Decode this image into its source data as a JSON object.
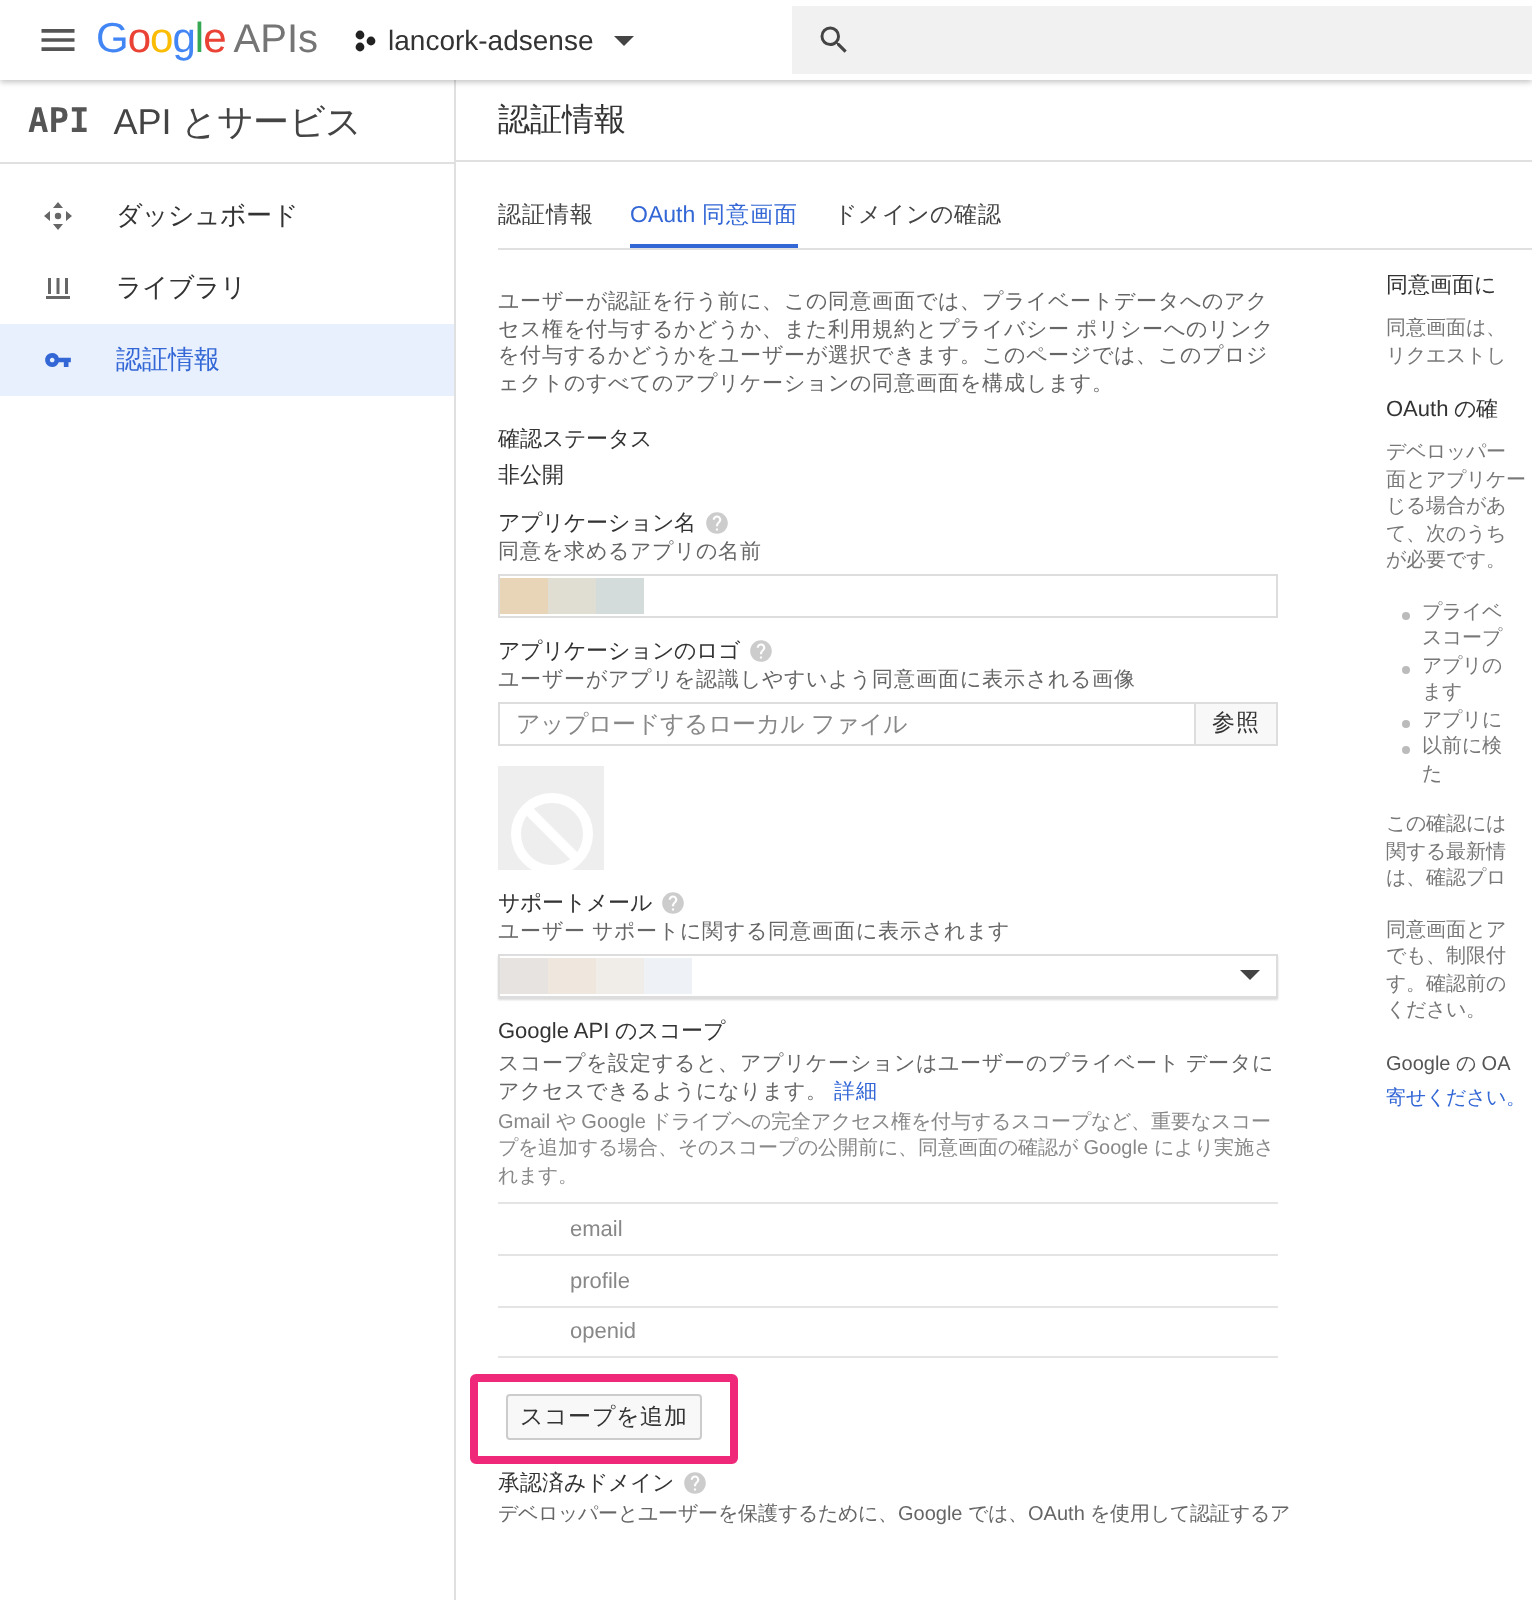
{
  "topbar": {
    "brand": "Google",
    "product": "APIs",
    "project": "lancork-adsense"
  },
  "sidebar": {
    "badge": "API",
    "title": "API とサービス",
    "items": [
      {
        "label": "ダッシュボード",
        "selected": false
      },
      {
        "label": "ライブラリ",
        "selected": false
      },
      {
        "label": "認証情報",
        "selected": true
      }
    ]
  },
  "page_title": "認証情報",
  "tabs": [
    {
      "label": "認証情報",
      "selected": false
    },
    {
      "label": "OAuth 同意画面",
      "selected": true
    },
    {
      "label": "ドメインの確認",
      "selected": false
    }
  ],
  "form": {
    "intro": "ユーザーが認証を行う前に、この同意画面では、プライベートデータへのアクセス権を付与するかどうか、また利用規約とプライバシー ポリシーへのリンクを付与するかどうかをユーザーが選択できます。このページでは、このプロジェクトのすべてのアプリケーションの同意画面を構成します。",
    "status": {
      "label": "確認ステータス",
      "value": "非公開"
    },
    "app_name": {
      "label": "アプリケーション名",
      "hint": "同意を求めるアプリの名前"
    },
    "logo": {
      "label": "アプリケーションのロゴ",
      "hint": "ユーザーがアプリを認識しやすいよう同意画面に表示される画像",
      "placeholder": "アップロードするローカル ファイル",
      "browse": "参照"
    },
    "support_email": {
      "label": "サポートメール",
      "hint": "ユーザー サポートに関する同意画面に表示されます"
    },
    "scopes": {
      "label": "Google API のスコープ",
      "description": "スコープを設定すると、アプリケーションはユーザーのプライベート データにアクセスできるようになります。",
      "link": "詳細",
      "note": "Gmail や Google ドライブへの完全アクセス権を付与するスコープなど、重要なスコープを追加する場合、そのスコープの公開前に、同意画面の確認が Google により実施されます。",
      "items": [
        "email",
        "profile",
        "openid"
      ],
      "add_button": "スコープを追加",
      "add_highlighted": true
    },
    "domains": {
      "label": "承認済みドメイン",
      "description": "デベロッパーとユーザーを保護するために、Google では、OAuth を使用して認証するア"
    }
  },
  "side_panel": {
    "blocks": [
      {
        "kind": "heading",
        "lines": [
          "同意画面に"
        ]
      },
      {
        "kind": "text",
        "lines": [
          "同意画面は、",
          "リクエストし"
        ]
      },
      {
        "kind": "heading",
        "lines": [
          "OAuth の確"
        ]
      },
      {
        "kind": "text",
        "lines": [
          "デベロッパー",
          "面とアプリケー",
          "じる場合があ",
          "て、次のうち",
          "が必要です。"
        ]
      },
      {
        "kind": "bullets",
        "items": [
          [
            "プライベ",
            "スコープ"
          ],
          [
            "アプリの",
            "ます"
          ],
          [
            "アプリに"
          ],
          [
            "以前に検",
            "た"
          ]
        ]
      },
      {
        "kind": "text",
        "lines": [
          "この確認には",
          "関する最新情",
          "は、確認プロ"
        ]
      },
      {
        "kind": "text",
        "lines": [
          "同意画面とア",
          "でも、制限付",
          "す。確認前の",
          "ください。"
        ]
      },
      {
        "kind": "footer",
        "lines": [
          "Google の OA"
        ],
        "link": "寄せください。"
      }
    ]
  }
}
